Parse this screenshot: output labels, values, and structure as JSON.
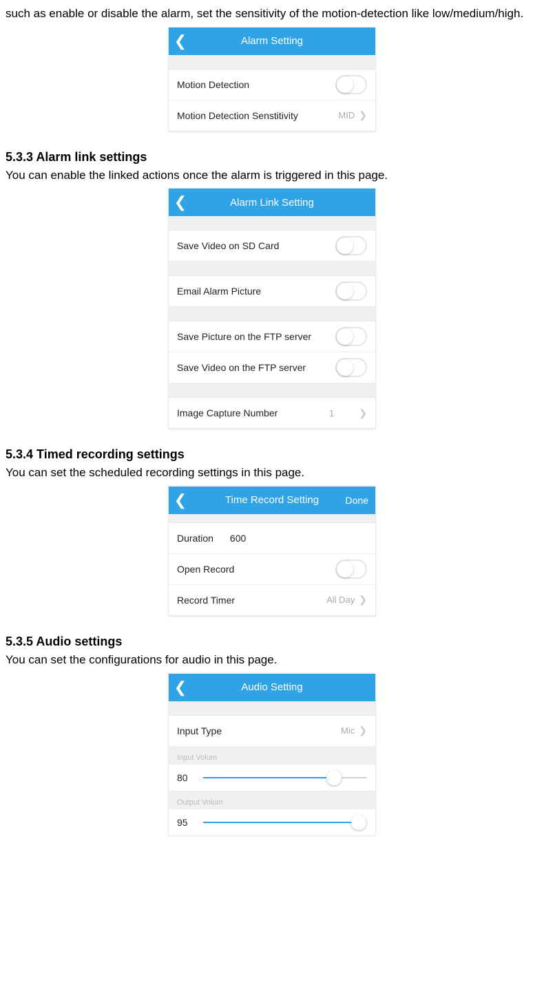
{
  "intro_text": "such as enable or disable the alarm, set the sensitivity of the motion-detection like low/medium/high.",
  "sections": {
    "s533": {
      "heading": "5.3.3 Alarm link settings",
      "body": "You can enable the linked actions once the alarm is triggered in this page."
    },
    "s534": {
      "heading": "5.3.4 Timed recording settings",
      "body": "You can set the scheduled recording settings in this page."
    },
    "s535": {
      "heading": "5.3.5 Audio settings",
      "body": "You can set the configurations for audio in this page."
    }
  },
  "screens": {
    "alarm": {
      "title": "Alarm Setting",
      "rows": {
        "motion": "Motion Detection",
        "sens_label": "Motion Detection Senstitivity",
        "sens_value": "MID"
      }
    },
    "alarm_link": {
      "title": "Alarm Link Setting",
      "rows": {
        "save_sd": "Save Video on SD Card",
        "email": "Email Alarm Picture",
        "pic_ftp": "Save Picture on the FTP server",
        "vid_ftp": "Save Video on the FTP server",
        "capture_label": "Image Capture Number",
        "capture_value": "1"
      }
    },
    "time_record": {
      "title": "Time Record Setting",
      "done": "Done",
      "rows": {
        "duration_label": "Duration",
        "duration_value": "600",
        "open_record": "Open Record",
        "timer_label": "Record Timer",
        "timer_value": "All Day"
      }
    },
    "audio": {
      "title": "Audio Setting",
      "rows": {
        "input_type_label": "Input Type",
        "input_type_value": "Mic",
        "input_volume_label": "Input Volum",
        "input_volume_value": "80",
        "output_volume_label": "Output Volum",
        "output_volume_value": "95"
      },
      "slider": {
        "in_pct": 80,
        "out_pct": 95
      }
    }
  }
}
